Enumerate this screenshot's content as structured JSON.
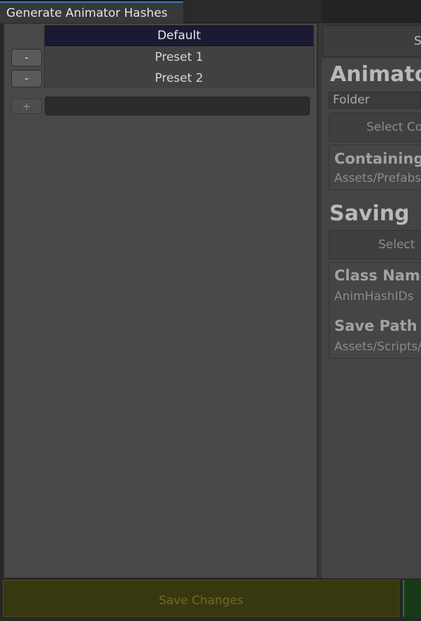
{
  "window": {
    "tab_title": "Generate Animator Hashes"
  },
  "presets": {
    "items": [
      {
        "label": "Default",
        "selected": true
      },
      {
        "label": "Preset 1",
        "remove_label": "-"
      },
      {
        "label": "Preset 2",
        "remove_label": "-"
      }
    ],
    "add_label": "+",
    "new_name_value": ""
  },
  "right_panel": {
    "top_button_label": "S",
    "animator_section_title": "Animator",
    "mode_select_value": "Folder",
    "select_folder_button": "Select Co",
    "containing_label": "Containing",
    "containing_value": "Assets/Prefabs",
    "saving_section_title": "Saving",
    "select_save_button": "Select",
    "class_name_label": "Class Name",
    "class_name_value": "AnimHashIDs",
    "save_path_label": "Save Path",
    "save_path_value": "Assets/Scripts/"
  },
  "footer": {
    "save_changes_label": "Save Changes"
  },
  "colors": {
    "tab_accent": "#3a79bb",
    "selected_row": "#1a1a33",
    "save_button": "#383810",
    "confirm_button": "#1f7a1f"
  }
}
